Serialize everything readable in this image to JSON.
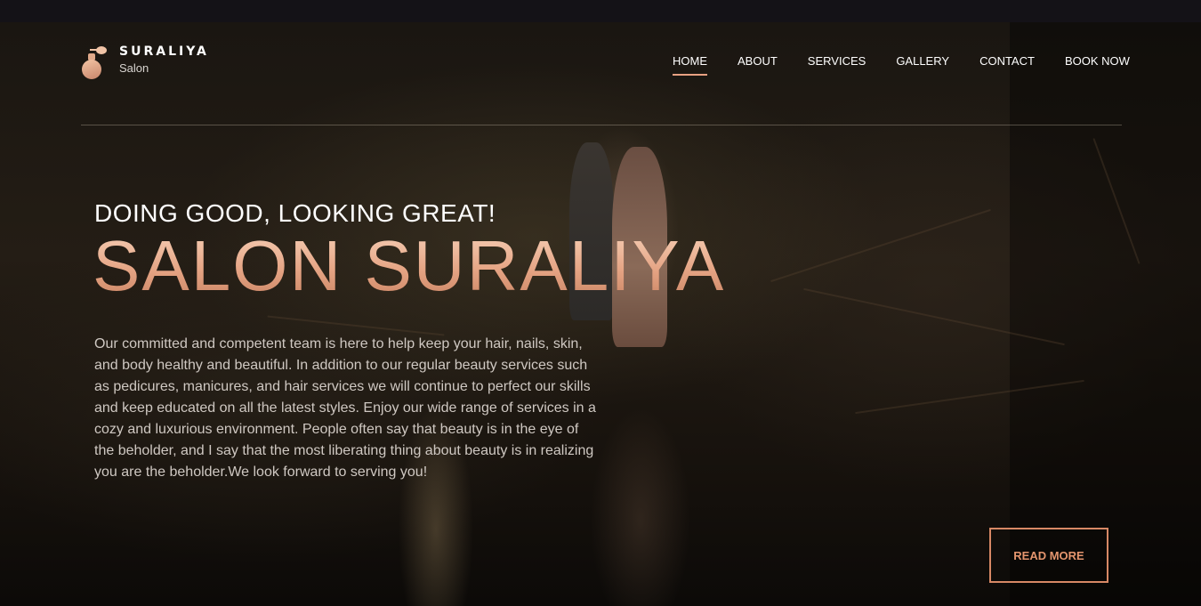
{
  "brand": {
    "name": "SURALIYA",
    "subtitle": "Salon",
    "icon": "perfume-bottle-icon"
  },
  "nav": {
    "items": [
      {
        "label": "HOME",
        "active": true
      },
      {
        "label": "ABOUT"
      },
      {
        "label": "SERVICES"
      },
      {
        "label": "GALLERY"
      },
      {
        "label": "CONTACT"
      },
      {
        "label": "BOOK NOW"
      }
    ]
  },
  "hero": {
    "tagline": "DOING GOOD, LOOKING GREAT!",
    "headline": "SALON SURALIYA",
    "description": "Our committed and competent team is here to help keep your hair, nails, skin, and body healthy and beautiful. In addition to our regular beauty services such as pedicures, manicures, and hair services we will continue to perfect our skills and keep educated on all the latest styles. Enjoy our wide range of services in a cozy and luxurious environment. People often say that beauty is in the eye of the beholder, and I say that the most liberating thing about beauty is in realizing you are the beholder.We look forward to serving you!",
    "cta_label": "READ MORE"
  },
  "colors": {
    "accent": "#e8a182",
    "cta_border": "#d78865",
    "background": "#0d0b0a"
  }
}
